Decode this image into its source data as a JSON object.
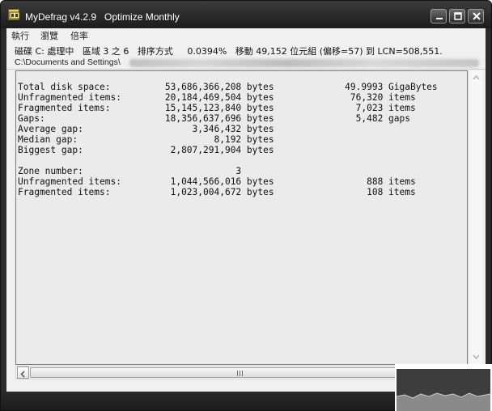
{
  "window": {
    "title": "MyDefrag v4.2.9   Optimize Monthly",
    "app_icon": "mydefrag-app-icon"
  },
  "title_buttons": {
    "minimize_icon": "minimize-icon",
    "maximize_icon": "maximize-icon",
    "close_icon": "close-icon"
  },
  "menu": {
    "items": [
      {
        "label": "執行"
      },
      {
        "label": "瀏覽"
      },
      {
        "label": "倍率"
      }
    ]
  },
  "status": {
    "line1": "磁碟 C: 處理中   區域 3 之 6   排序方式     0.0394%   移動 49,152 位元組 (偏移=57) 到 LCN=508,551.",
    "path_prefix": "C:\\Documents and Settings\\"
  },
  "report": {
    "rows": [
      {
        "label": "Total disk space:",
        "value": "53,686,366,208",
        "unit": "bytes",
        "extra": "49.9993 GigaBytes"
      },
      {
        "label": "Unfragmented items:",
        "value": "20,184,469,504",
        "unit": "bytes",
        "extra": "76,320 items"
      },
      {
        "label": "Fragmented items:",
        "value": "15,145,123,840",
        "unit": "bytes",
        "extra": "7,023 items"
      },
      {
        "label": "Gaps:",
        "value": "18,356,637,696",
        "unit": "bytes",
        "extra": "5,482 gaps"
      },
      {
        "label": "Average gap:",
        "value": "3,346,432",
        "unit": "bytes",
        "extra": ""
      },
      {
        "label": "Median gap:",
        "value": "8,192",
        "unit": "bytes",
        "extra": ""
      },
      {
        "label": "Biggest gap:",
        "value": "2,807,291,904",
        "unit": "bytes",
        "extra": ""
      },
      {
        "label": "",
        "value": "",
        "unit": "",
        "extra": ""
      },
      {
        "label": "Zone number:",
        "value": "3",
        "unit": "",
        "extra": ""
      },
      {
        "label": "Unfragmented items:",
        "value": "1,044,566,016",
        "unit": "bytes",
        "extra": "888 items"
      },
      {
        "label": "Fragmented items:",
        "value": "1,023,004,672",
        "unit": "bytes",
        "extra": "108 items"
      }
    ]
  },
  "scrollbars": {
    "up_icon": "scroll-up-arrow-icon",
    "down_icon": "scroll-down-arrow-icon",
    "left_icon": "scroll-left-arrow-icon",
    "grip_icon": "scroll-grip-icon"
  },
  "colors": {
    "frame": "#2b2b2b",
    "panel": "#ebebeb",
    "client": "#f0f0f0",
    "text": "#111111"
  }
}
